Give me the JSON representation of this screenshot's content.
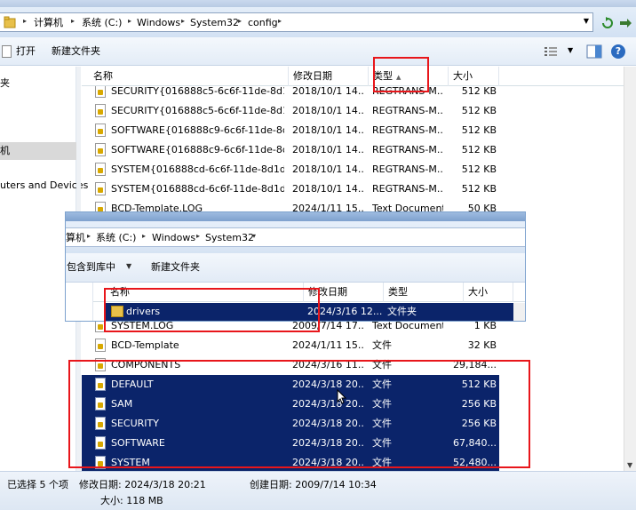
{
  "main": {
    "breadcrumb": [
      "计算机",
      "系统 (C:)",
      "Windows",
      "System32",
      "config"
    ],
    "toolbar": {
      "open_label": "打开",
      "new_folder_label": "新建文件夹"
    },
    "nav": {
      "item_top": "夹",
      "item_selected": "机",
      "item_devices": "uters and Devices"
    },
    "columns": {
      "name": "名称",
      "date": "修改日期",
      "type": "类型",
      "size": "大小"
    },
    "rows": [
      {
        "name": "SECURITY{016888c5-6c6f-11de-8d1...",
        "date": "2018/10/1 14...",
        "type": "REGTRANS-M...",
        "size": "512 KB",
        "selected": false
      },
      {
        "name": "SECURITY{016888c5-6c6f-11de-8d1...",
        "date": "2018/10/1 14...",
        "type": "REGTRANS-M...",
        "size": "512 KB",
        "selected": false
      },
      {
        "name": "SOFTWARE{016888c9-6c6f-11de-8d...",
        "date": "2018/10/1 14...",
        "type": "REGTRANS-M...",
        "size": "512 KB",
        "selected": false
      },
      {
        "name": "SOFTWARE{016888c9-6c6f-11de-8d...",
        "date": "2018/10/1 14...",
        "type": "REGTRANS-M...",
        "size": "512 KB",
        "selected": false
      },
      {
        "name": "SYSTEM{016888cd-6c6f-11de-8d1d-...",
        "date": "2018/10/1 14...",
        "type": "REGTRANS-M...",
        "size": "512 KB",
        "selected": false
      },
      {
        "name": "SYSTEM{016888cd-6c6f-11de-8d1d-...",
        "date": "2018/10/1 14...",
        "type": "REGTRANS-M...",
        "size": "512 KB",
        "selected": false
      },
      {
        "name": "BCD-Template.LOG",
        "date": "2024/1/11 15...",
        "type": "Text Document",
        "size": "50 KB",
        "selected": false
      },
      {
        "name": "",
        "date": "",
        "type": "",
        "size": "",
        "selected": false
      },
      {
        "name": "",
        "date": "",
        "type": "",
        "size": "",
        "selected": false
      },
      {
        "name": "",
        "date": "",
        "type": "",
        "size": "",
        "selected": false
      },
      {
        "name": "",
        "date": "",
        "type": "",
        "size": "",
        "selected": false
      },
      {
        "name": "",
        "date": "",
        "type": "",
        "size": "",
        "selected": false
      },
      {
        "name": "SYSTEM.LOG",
        "date": "2009/7/14 17...",
        "type": "Text Document",
        "size": "1 KB",
        "selected": false
      },
      {
        "name": "BCD-Template",
        "date": "2024/1/11 15...",
        "type": "文件",
        "size": "32 KB",
        "selected": false
      },
      {
        "name": "COMPONENTS",
        "date": "2024/3/16 11...",
        "type": "文件",
        "size": "29,184...",
        "selected": false
      },
      {
        "name": "DEFAULT",
        "date": "2024/3/18 20...",
        "type": "文件",
        "size": "512 KB",
        "selected": true
      },
      {
        "name": "SAM",
        "date": "2024/3/18 20...",
        "type": "文件",
        "size": "256 KB",
        "selected": true
      },
      {
        "name": "SECURITY",
        "date": "2024/3/18 20...",
        "type": "文件",
        "size": "256 KB",
        "selected": true
      },
      {
        "name": "SOFTWARE",
        "date": "2024/3/18 20...",
        "type": "文件",
        "size": "67,840...",
        "selected": true
      },
      {
        "name": "SYSTEM",
        "date": "2024/3/18 20...",
        "type": "文件",
        "size": "52,480...",
        "selected": true
      }
    ],
    "status": {
      "selected_count": "已选择 5 个项",
      "modified": "修改日期: 2024/3/18 20:21",
      "created": "创建日期: 2009/7/14 10:34",
      "size": "大小: 118 MB"
    }
  },
  "overlay": {
    "breadcrumb": [
      "算机",
      "系统 (C:)",
      "Windows",
      "System32"
    ],
    "toolbar": {
      "include_label": "包含到库中",
      "new_folder_label": "新建文件夹"
    },
    "columns": {
      "name": "名称",
      "date": "修改日期",
      "type": "类型",
      "size": "大小"
    },
    "row": {
      "name": "drivers",
      "date": "2024/3/16 12...",
      "type": "文件夹",
      "size": ""
    }
  },
  "colors": {
    "selection": "#0b246a",
    "annotation": "#e8161b",
    "folder": "#e8c04a"
  },
  "icons": [
    "folder-icon",
    "file-icon",
    "lock-icon",
    "views-icon",
    "preview-pane-icon",
    "help-icon",
    "refresh-icon",
    "cursor-icon"
  ]
}
